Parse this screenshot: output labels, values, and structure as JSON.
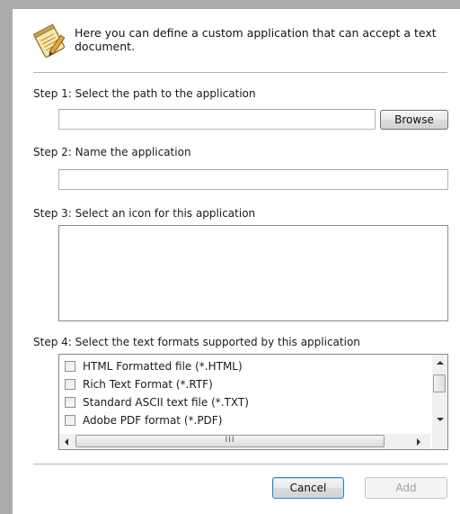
{
  "header": {
    "text": "Here you can define a custom application that can accept a text document.",
    "icon": "notepad-pen-icon"
  },
  "step1": {
    "label": "Step 1: Select the path to the application",
    "path_value": "",
    "browse_label": "Browse"
  },
  "step2": {
    "label": "Step 2: Name the application",
    "name_value": ""
  },
  "step3": {
    "label": "Step 3: Select an icon for this application"
  },
  "step4": {
    "label": "Step 4: Select the text formats supported by this application",
    "formats": [
      {
        "label": "HTML Formatted file (*.HTML)",
        "checked": false
      },
      {
        "label": "Rich Text Format (*.RTF)",
        "checked": false
      },
      {
        "label": "Standard ASCII text file (*.TXT)",
        "checked": false
      },
      {
        "label": "Adobe PDF format (*.PDF)",
        "checked": false
      }
    ],
    "hscroll_grip": "III"
  },
  "footer": {
    "cancel_label": "Cancel",
    "add_label": "Add"
  },
  "colors": {
    "focus_border": "#3c7fb1",
    "dialog_bg": "#ffffff",
    "window_bg": "#ababab"
  }
}
